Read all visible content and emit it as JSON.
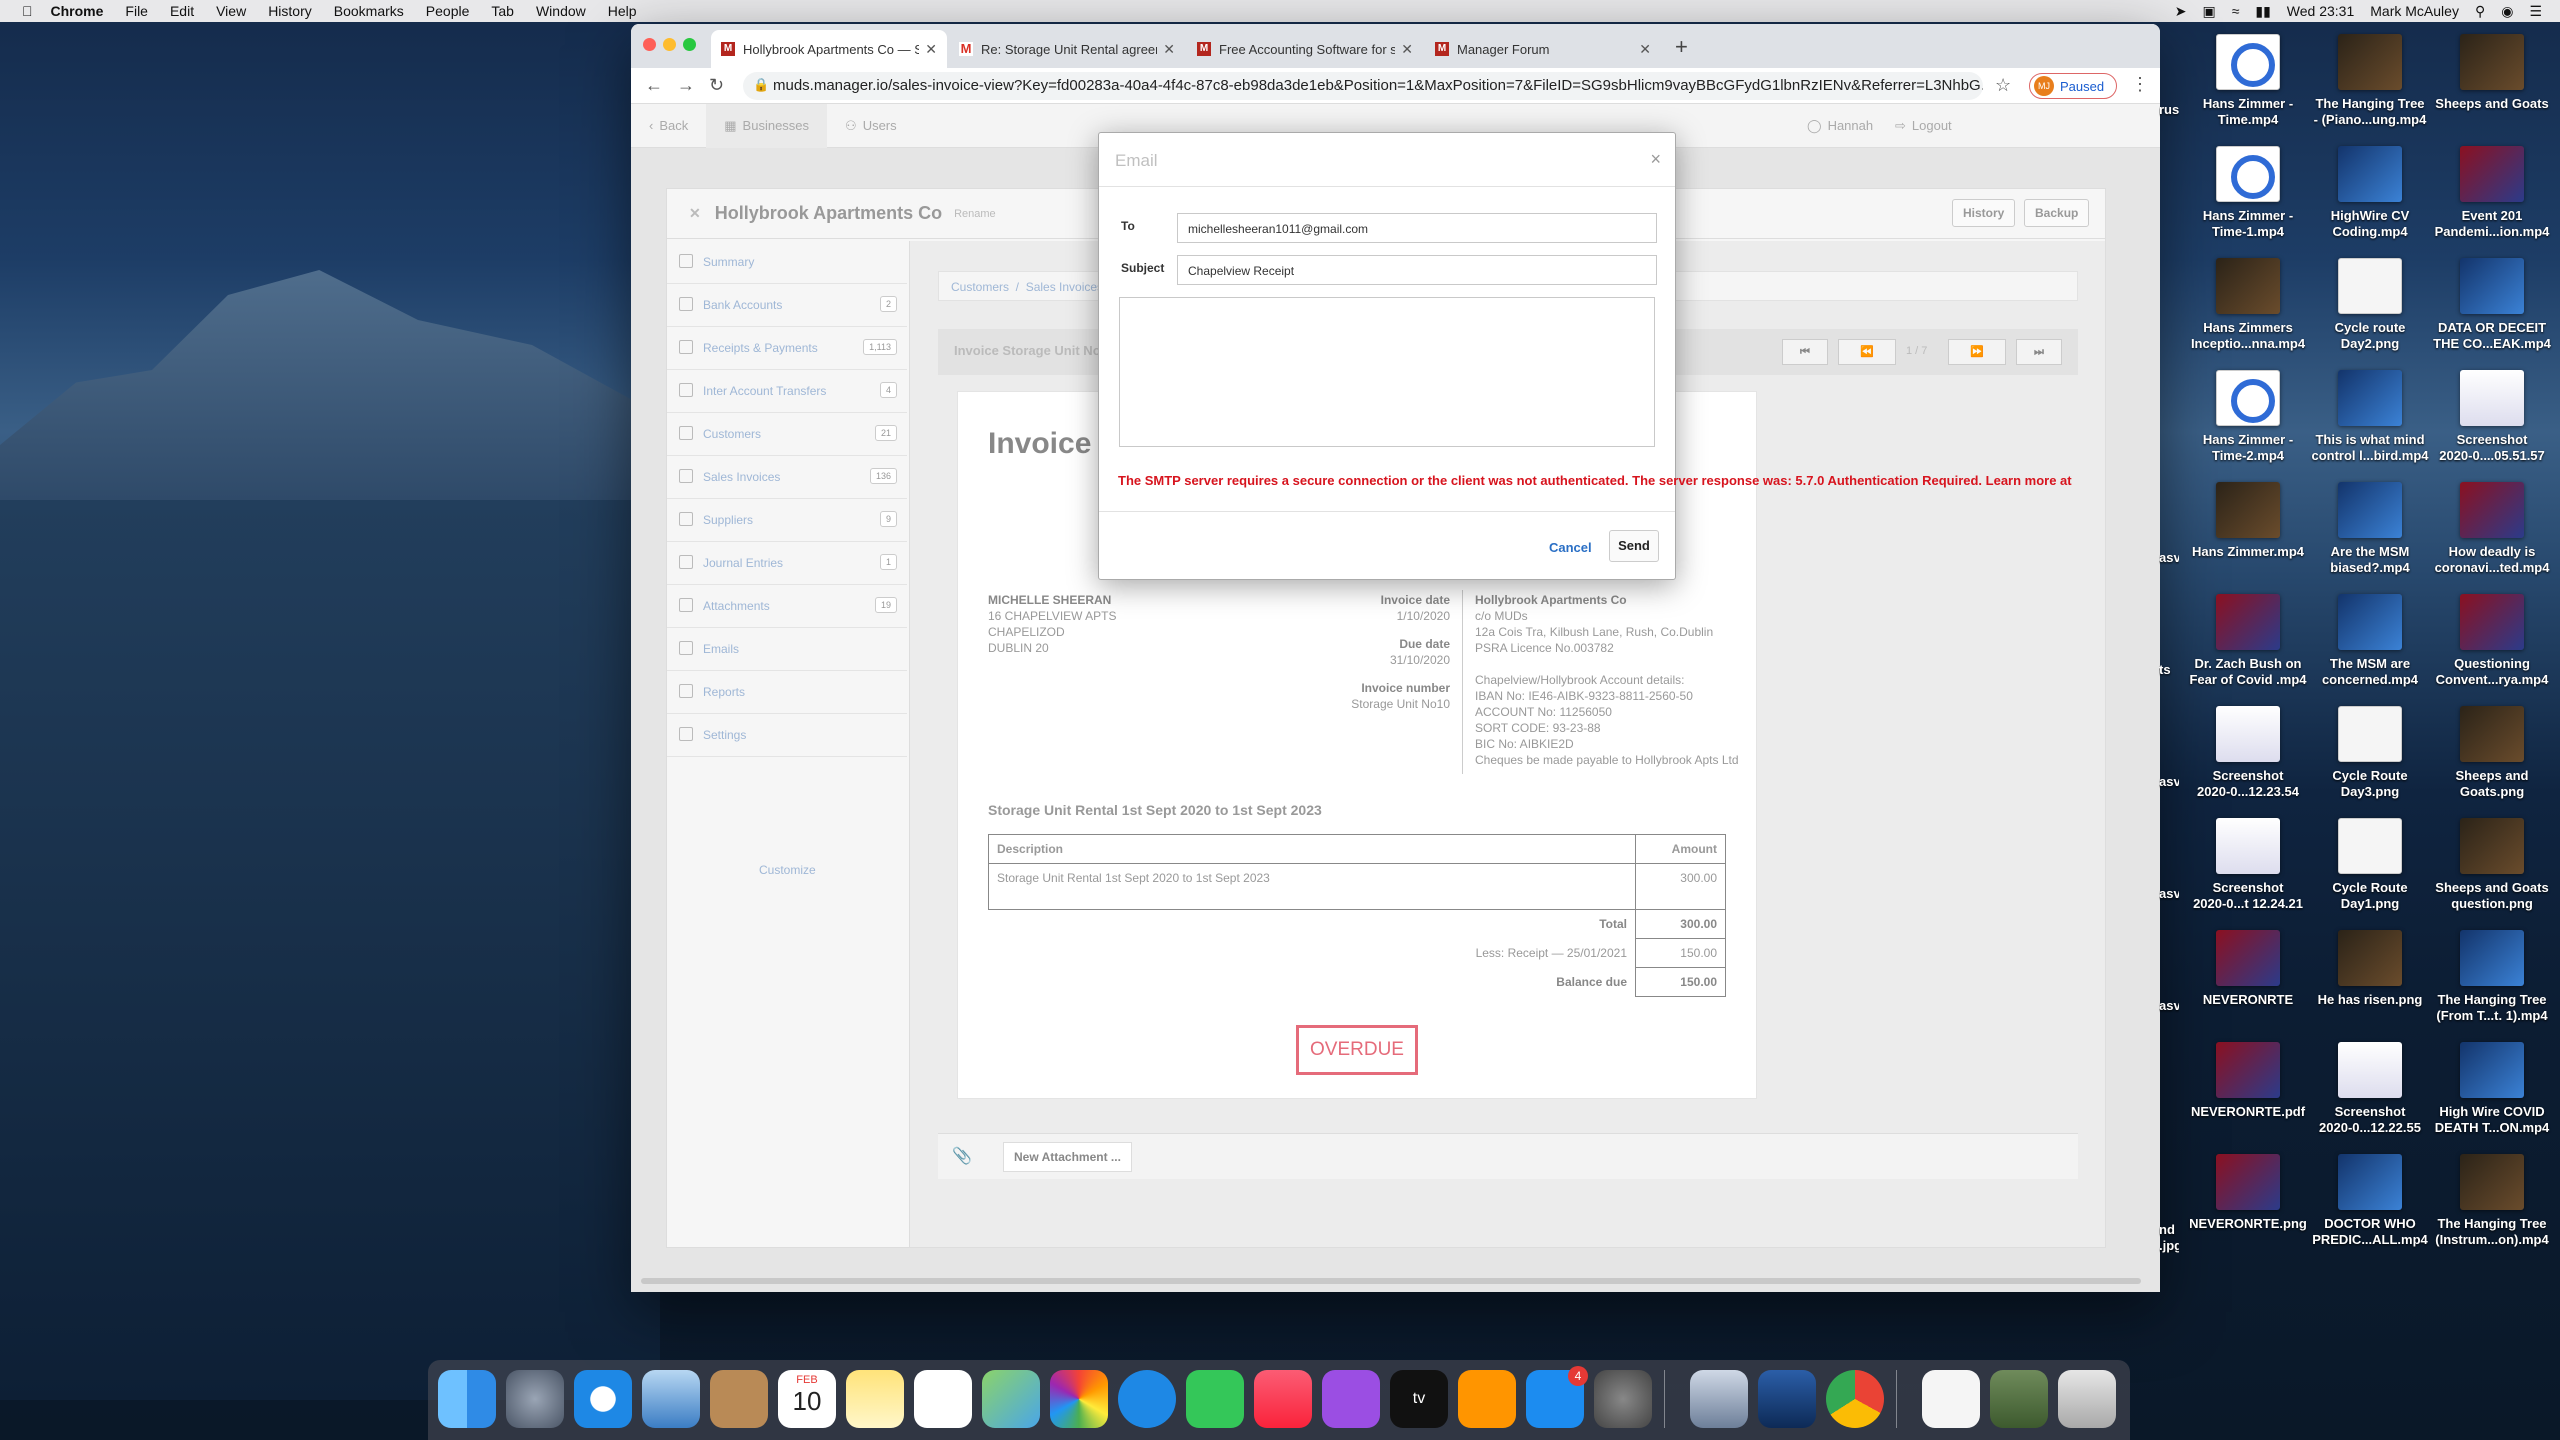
{
  "menubar": {
    "app": "Chrome",
    "items": [
      "File",
      "Edit",
      "View",
      "History",
      "Bookmarks",
      "People",
      "Tab",
      "Window",
      "Help"
    ],
    "clock": "Wed 23:31",
    "user": "Mark McAuley"
  },
  "tabs": [
    {
      "label": "Hollybrook Apartments Co — Sa",
      "icon": "manager-icon"
    },
    {
      "label": "Re: Storage Unit Rental agreem",
      "icon": "gmail-icon"
    },
    {
      "label": "Free Accounting Software for sm",
      "icon": "manager-icon"
    },
    {
      "label": "Manager Forum",
      "icon": "manager-icon"
    }
  ],
  "address": {
    "url": "muds.manager.io/sales-invoice-view?Key=fd00283a-40a4-4f4c-87c8-eb98da3de1eb&Position=1&MaxPosition=7&FileID=SG9sbHlicm9vayBBcGFydG1lbnRzIENv&Referrer=L3NhbG...",
    "profile_initials": "MJ",
    "profile_status": "Paused"
  },
  "apptop": {
    "back": "Back",
    "businesses": "Businesses",
    "users": "Users",
    "user": "Hannah",
    "logout": "Logout"
  },
  "business": {
    "name": "Hollybrook Apartments Co",
    "rename": "Rename",
    "history": "History",
    "backup": "Backup"
  },
  "sidebar": [
    {
      "label": "Summary",
      "count": ""
    },
    {
      "label": "Bank Accounts",
      "count": "2"
    },
    {
      "label": "Receipts & Payments",
      "count": "1,113"
    },
    {
      "label": "Inter Account Transfers",
      "count": "4"
    },
    {
      "label": "Customers",
      "count": "21"
    },
    {
      "label": "Sales Invoices",
      "count": "136"
    },
    {
      "label": "Suppliers",
      "count": "9"
    },
    {
      "label": "Journal Entries",
      "count": "1"
    },
    {
      "label": "Attachments",
      "count": "19"
    },
    {
      "label": "Emails",
      "count": ""
    },
    {
      "label": "Reports",
      "count": ""
    },
    {
      "label": "Settings",
      "count": ""
    }
  ],
  "customize": "Customize",
  "crumbs": {
    "customers": "Customers",
    "sales_invoices": "Sales Invoices"
  },
  "invbar": {
    "title": "Invoice Storage Unit No10",
    "pager": "1 / 7"
  },
  "invoice": {
    "title": "Invoice",
    "customer": [
      "MICHELLE SHEERAN",
      "16 CHAPELVIEW APTS",
      "CHAPELIZOD",
      "DUBLIN 20"
    ],
    "invoice_date_label": "Invoice date",
    "invoice_date": "1/10/2020",
    "due_date_label": "Due date",
    "due_date": "31/10/2020",
    "number_label": "Invoice number",
    "number": "Storage Unit No10",
    "company": [
      "Hollybrook Apartments Co",
      "c/o MUDs",
      "12a Cois Tra, Kilbush Lane, Rush, Co.Dublin",
      "PSRA Licence No.003782",
      "",
      "Chapelview/Hollybrook Account details:",
      "IBAN No: IE46-AIBK-9323-8811-2560-50",
      "ACCOUNT No: 11256050",
      "SORT CODE: 93-23-88",
      "BIC No: AIBKIE2D",
      "Cheques be made payable to Hollybrook Apts Ltd"
    ],
    "desc_title": "Storage Unit Rental 1st Sept 2020 to 1st Sept 2023",
    "col_desc": "Description",
    "col_amount": "Amount",
    "line_desc": "Storage Unit Rental 1st Sept 2020 to 1st Sept 2023",
    "line_amount": "300.00",
    "total_label": "Total",
    "total": "300.00",
    "receipt_label": "Less: Receipt — 25/01/2021",
    "receipt": "150.00",
    "balance_label": "Balance due",
    "balance": "150.00",
    "status": "OVERDUE"
  },
  "new_attachment": "New Attachment ...",
  "email_modal": {
    "title": "Email",
    "to_label": "To",
    "to": "michellesheeran1011@gmail.com",
    "subject_label": "Subject",
    "subject": "Chapelview Receipt",
    "body": "",
    "error": "The SMTP server requires a secure connection or the client was not authenticated. The server response was: 5.7.0 Authentication Required. Learn more at",
    "cancel": "Cancel",
    "send": "Send"
  },
  "desktop": [
    [
      "Hans Zimmer -",
      "Time.mp4"
    ],
    [
      "The Hanging Tree",
      "- (Piano...ung.mp4"
    ],
    [
      "Sheeps and Goats",
      ""
    ],
    [
      "Hans Zimmer -",
      "Time-1.mp4"
    ],
    [
      "HighWire CV",
      "Coding.mp4"
    ],
    [
      "Event 201",
      "Pandemi...ion.mp4"
    ],
    [
      "Hans Zimmers",
      "Inceptio...nna.mp4"
    ],
    [
      "Cycle route",
      "Day2.png"
    ],
    [
      "DATA OR DECEIT",
      "THE CO...EAK.mp4"
    ],
    [
      "Hans Zimmer -",
      "Time-2.mp4"
    ],
    [
      "This is what mind",
      "control l...bird.mp4"
    ],
    [
      "Screenshot",
      "2020-0....05.51.57"
    ],
    [
      "Hans Zimmer.mp4",
      ""
    ],
    [
      "Are the MSM",
      "biased?.mp4"
    ],
    [
      "How deadly is",
      "coronavi...ted.mp4"
    ],
    [
      "Dr. Zach Bush on",
      "Fear of Covid .mp4"
    ],
    [
      "The MSM are",
      "concerned.mp4"
    ],
    [
      "Questioning",
      "Convent...rya.mp4"
    ],
    [
      "Screenshot",
      "2020-0...12.23.54"
    ],
    [
      "Cycle Route",
      "Day3.png"
    ],
    [
      "Sheeps and",
      "Goats.png"
    ],
    [
      "Screenshot",
      "2020-0...t 12.24.21"
    ],
    [
      "Cycle Route",
      "Day1.png"
    ],
    [
      "Sheeps and Goats",
      "question.png"
    ],
    [
      "NEVERONRTE",
      ""
    ],
    [
      "He has risen.png",
      ""
    ],
    [
      "The Hanging Tree",
      "(From T...t. 1).mp4"
    ],
    [
      "NEVERONRTE.pdf",
      ""
    ],
    [
      "Screenshot",
      "2020-0...12.22.55"
    ],
    [
      "High Wire COVID",
      "DEATH T...ON.mp4"
    ],
    [
      "NEVERONRTE.png",
      ""
    ],
    [
      "DOCTOR WHO",
      "PREDIC...ALL.mp4"
    ],
    [
      "The Hanging Tree",
      "(Instrum...on).mp4"
    ]
  ],
  "desktop_edge": [
    "rus",
    "",
    "",
    "asv2",
    "ts",
    "asv2",
    "asv2",
    "asv2",
    "",
    "",
    "nd",
    ".jpg"
  ],
  "dock_badge": "4",
  "calendar": {
    "month": "FEB",
    "day": "10"
  }
}
